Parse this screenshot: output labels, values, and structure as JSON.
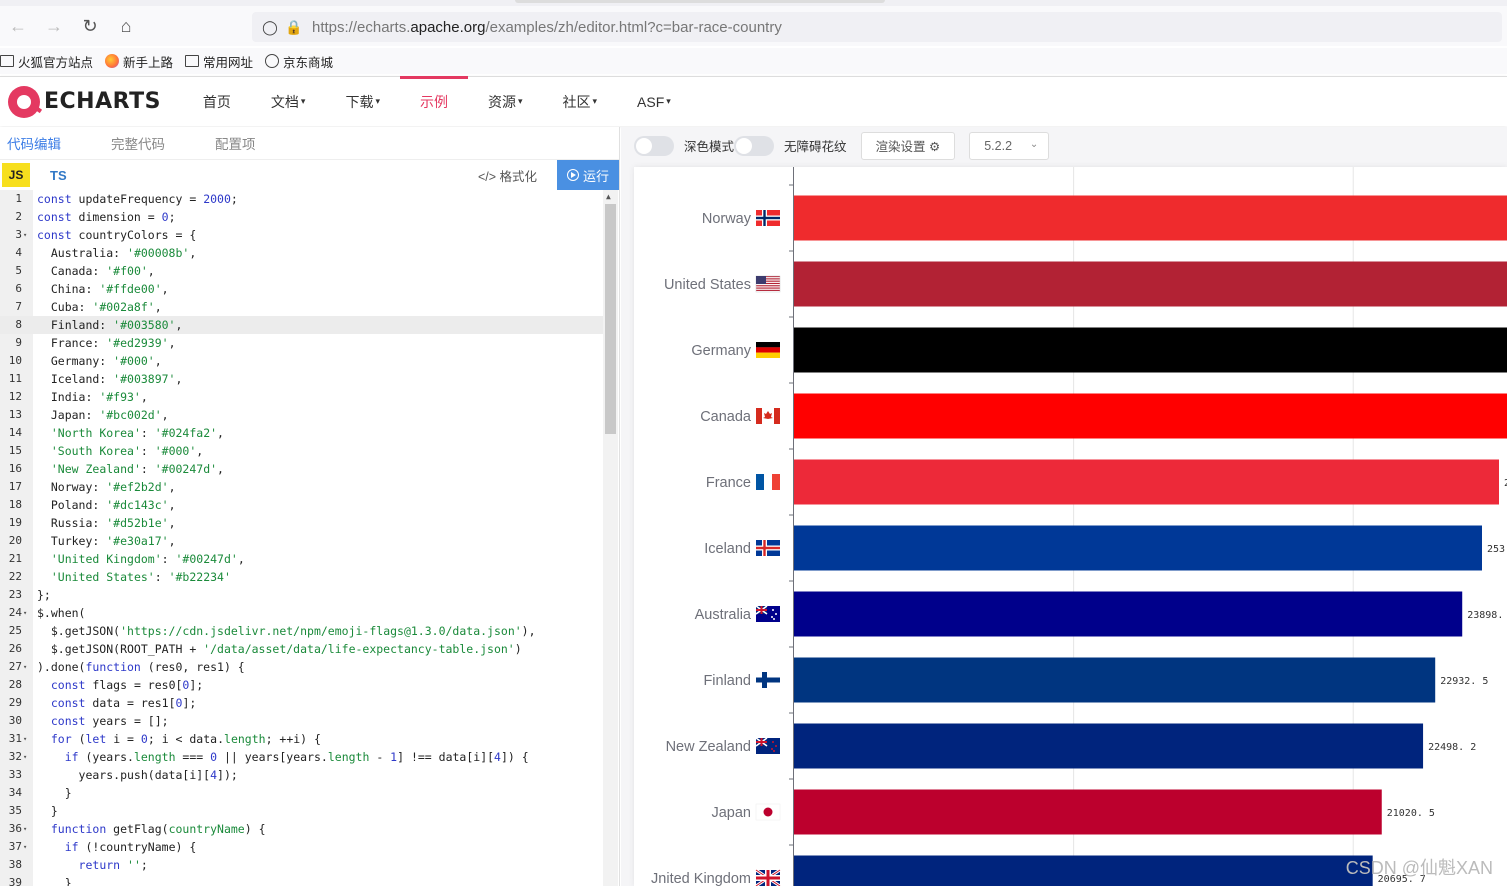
{
  "browser": {
    "url_prefix": "https://echarts.",
    "url_domain": "apache.org",
    "url_suffix": "/examples/zh/editor.html?c=bar-race-country",
    "bookmarks": [
      "火狐官方站点",
      "新手上路",
      "常用网址",
      "京东商城"
    ]
  },
  "site": {
    "logo_text": "ECHARTS",
    "menu": [
      {
        "label": "首页",
        "caret": ""
      },
      {
        "label": "文档",
        "caret": "▾"
      },
      {
        "label": "下载",
        "caret": "▾"
      },
      {
        "label": "示例",
        "caret": "",
        "active": true
      },
      {
        "label": "资源",
        "caret": "▾"
      },
      {
        "label": "社区",
        "caret": "▾"
      },
      {
        "label": "ASF",
        "caret": "▾"
      }
    ],
    "accent": "#e43961"
  },
  "editor": {
    "tabs": [
      "代码编辑",
      "完整代码",
      "配置项"
    ],
    "lang_js": "JS",
    "lang_ts": "TS",
    "format_label": "</> 格式化",
    "run_label": "运行",
    "lines": [
      {
        "n": "1",
        "fold": "",
        "html": "<span class='kw'>const</span> updateFrequency = <span class='num'>2000</span>;"
      },
      {
        "n": "2",
        "fold": "",
        "html": "<span class='kw'>const</span> dimension = <span class='num'>0</span>;"
      },
      {
        "n": "3",
        "fold": "▾",
        "html": "<span class='kw'>const</span> countryColors = {"
      },
      {
        "n": "4",
        "fold": "",
        "html": "  Australia: <span class='str'>'#00008b'</span>,"
      },
      {
        "n": "5",
        "fold": "",
        "html": "  Canada: <span class='str'>'#f00'</span>,"
      },
      {
        "n": "6",
        "fold": "",
        "html": "  China: <span class='str'>'#ffde00'</span>,"
      },
      {
        "n": "7",
        "fold": "",
        "html": "  Cuba: <span class='str'>'#002a8f'</span>,"
      },
      {
        "n": "8",
        "fold": "",
        "html": "  Finland: <span class='str'>'#003580'</span>,",
        "hl": true
      },
      {
        "n": "9",
        "fold": "",
        "html": "  France: <span class='str'>'#ed2939'</span>,"
      },
      {
        "n": "10",
        "fold": "",
        "html": "  Germany: <span class='str'>'#000'</span>,"
      },
      {
        "n": "11",
        "fold": "",
        "html": "  Iceland: <span class='str'>'#003897'</span>,"
      },
      {
        "n": "12",
        "fold": "",
        "html": "  India: <span class='str'>'#f93'</span>,"
      },
      {
        "n": "13",
        "fold": "",
        "html": "  Japan: <span class='str'>'#bc002d'</span>,"
      },
      {
        "n": "14",
        "fold": "",
        "html": "  <span class='str'>'North Korea'</span>: <span class='str'>'#024fa2'</span>,"
      },
      {
        "n": "15",
        "fold": "",
        "html": "  <span class='str'>'South Korea'</span>: <span class='str'>'#000'</span>,"
      },
      {
        "n": "16",
        "fold": "",
        "html": "  <span class='str'>'New Zealand'</span>: <span class='str'>'#00247d'</span>,"
      },
      {
        "n": "17",
        "fold": "",
        "html": "  Norway: <span class='str'>'#ef2b2d'</span>,"
      },
      {
        "n": "18",
        "fold": "",
        "html": "  Poland: <span class='str'>'#dc143c'</span>,"
      },
      {
        "n": "19",
        "fold": "",
        "html": "  Russia: <span class='str'>'#d52b1e'</span>,"
      },
      {
        "n": "20",
        "fold": "",
        "html": "  Turkey: <span class='str'>'#e30a17'</span>,"
      },
      {
        "n": "21",
        "fold": "",
        "html": "  <span class='str'>'United Kingdom'</span>: <span class='str'>'#00247d'</span>,"
      },
      {
        "n": "22",
        "fold": "",
        "html": "  <span class='str'>'United States'</span>: <span class='str'>'#b22234'</span>"
      },
      {
        "n": "23",
        "fold": "",
        "html": "};"
      },
      {
        "n": "24",
        "fold": "▾",
        "html": "$.when("
      },
      {
        "n": "25",
        "fold": "",
        "html": "  $.getJSON(<span class='str'>'https://cdn.jsdelivr.net/npm/emoji-flags@1.3.0/data.json'</span>),"
      },
      {
        "n": "26",
        "fold": "",
        "html": "  $.getJSON(ROOT_PATH + <span class='str'>'/data/asset/data/life-expectancy-table.json'</span>)"
      },
      {
        "n": "27",
        "fold": "▾",
        "html": ").done(<span class='kw'>function</span> (res0, res1) {"
      },
      {
        "n": "28",
        "fold": "",
        "html": "  <span class='kw'>const</span> flags = res0[<span class='num'>0</span>];"
      },
      {
        "n": "29",
        "fold": "",
        "html": "  <span class='kw'>const</span> data = res1[<span class='num'>0</span>];"
      },
      {
        "n": "30",
        "fold": "",
        "html": "  <span class='kw'>const</span> years = [];"
      },
      {
        "n": "31",
        "fold": "▾",
        "html": "  <span class='kw'>for</span> (<span class='kw'>let</span> i = <span class='num'>0</span>; i &lt; data.<span class='prop'>length</span>; ++i) {"
      },
      {
        "n": "32",
        "fold": "▾",
        "html": "    <span class='kw'>if</span> (years.<span class='prop'>length</span> === <span class='num'>0</span> || years[years.<span class='prop'>length</span> - <span class='num'>1</span>] !== data[i][<span class='num'>4</span>]) {"
      },
      {
        "n": "33",
        "fold": "",
        "html": "      years.push(data[i][<span class='num'>4</span>]);"
      },
      {
        "n": "34",
        "fold": "",
        "html": "    }"
      },
      {
        "n": "35",
        "fold": "",
        "html": "  }"
      },
      {
        "n": "36",
        "fold": "▾",
        "html": "  <span class='kw'>function</span> getFlag(<span class='str'>countryName</span>) {"
      },
      {
        "n": "37",
        "fold": "▾",
        "html": "    <span class='kw'>if</span> (!countryName) {"
      },
      {
        "n": "38",
        "fold": "",
        "html": "      <span class='kw'>return</span> <span class='str'>''</span>;"
      },
      {
        "n": "39",
        "fold": "",
        "html": "    }"
      }
    ]
  },
  "preview": {
    "dark_mode_label": "深色模式",
    "aria_label": "无障碍花纹",
    "render_settings_label": "渲染设置 ⚙",
    "version": "5.2.2",
    "watermark": "CSDN @仙魁XAN"
  },
  "chart_data": {
    "type": "bar",
    "orientation": "horizontal",
    "bars": [
      {
        "name": "Norway",
        "color": "#ef2b2d",
        "flag": "norway",
        "value": null,
        "label": ""
      },
      {
        "name": "United States",
        "color": "#b22234",
        "flag": "usa",
        "value": null,
        "label": ""
      },
      {
        "name": "Germany",
        "color": "#000000",
        "flag": "germany",
        "value": null,
        "label": ""
      },
      {
        "name": "Canada",
        "color": "#ff0000",
        "flag": "canada",
        "value": null,
        "label": ""
      },
      {
        "name": "France",
        "color": "#ed2939",
        "flag": "france",
        "value": null,
        "label": "2"
      },
      {
        "name": "Iceland",
        "color": "#003897",
        "flag": "iceland",
        "value": null,
        "label": "253"
      },
      {
        "name": "Australia",
        "color": "#00008b",
        "flag": "australia",
        "value": 23898.5,
        "label": "23898. 5"
      },
      {
        "name": "Finland",
        "color": "#003580",
        "flag": "finland",
        "value": 22932.5,
        "label": "22932. 5"
      },
      {
        "name": "New Zealand",
        "color": "#00247d",
        "flag": "nz",
        "value": 22498.2,
        "label": "22498. 2"
      },
      {
        "name": "Japan",
        "color": "#bc002d",
        "flag": "japan",
        "value": 21020.5,
        "label": "21020. 5"
      },
      {
        "name": "Jnited Kingdom",
        "color": "#00247d",
        "flag": "uk",
        "value": 20695.7,
        "label": "20695. 7"
      }
    ],
    "grid": true,
    "xlim_visible": [
      0,
      25500
    ]
  }
}
